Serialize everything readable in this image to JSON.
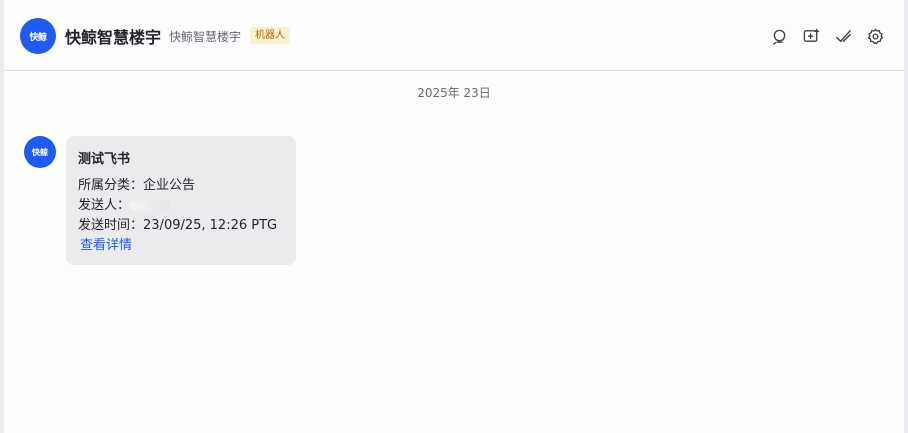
{
  "header": {
    "bot_avatar_text": "快鲸",
    "title": "快鲸智慧楼宇",
    "subtitle": "快鲸智慧楼宇",
    "badge": "机器人"
  },
  "toolbar": {
    "icons": [
      "search-icon",
      "add-window-icon",
      "checkmark-icon",
      "gear-icon"
    ]
  },
  "chat": {
    "date_separator": "2025年 23日",
    "message_avatar_text": "快鲸",
    "card": {
      "title": "测试飞书",
      "category_label": "所属分类：",
      "category_value": "企业公告",
      "sender_label": "发送人：",
      "time_label": "发送时间：",
      "time_value": "23/09/25, 12:26 PTG",
      "link_text": "查看详情"
    }
  },
  "colors": {
    "brand": "#1f5bf0",
    "badge_bg": "#faf1d1",
    "badge_text": "#b56a00",
    "card_bg": "#ebebed"
  }
}
